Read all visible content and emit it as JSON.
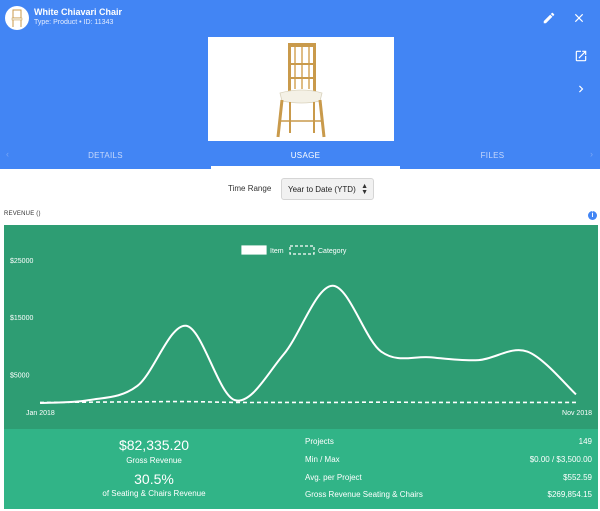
{
  "header": {
    "title": "White Chiavari Chair",
    "subtitle": "Type: Product • ID: 11343"
  },
  "tabs": [
    {
      "label": "DETAILS"
    },
    {
      "label": "USAGE",
      "active": true
    },
    {
      "label": "FILES"
    }
  ],
  "filters": {
    "time_range_label": "Time Range",
    "time_range_value": "Year to Date (YTD)"
  },
  "section": {
    "revenue_label": "REVENUE ()"
  },
  "colors": {
    "header": "#4285f4",
    "chart_bg": "#2e9d73",
    "stats_bg": "#31b487"
  },
  "chart_data": {
    "type": "line",
    "legend": [
      "Item",
      "Category"
    ],
    "legend_position": "top-center",
    "y_ticks": [
      "$25000",
      "$15000",
      "$5000"
    ],
    "x_tick_labels": [
      "Jan 2018",
      "Nov 2018"
    ],
    "ylim": [
      0,
      25000
    ],
    "grid": false,
    "series": [
      {
        "name": "Item",
        "style": "solid",
        "values": [
          0,
          500,
          3000,
          13500,
          500,
          8500,
          20500,
          9000,
          8000,
          7500,
          9000,
          1500
        ]
      },
      {
        "name": "Category",
        "style": "dashed",
        "values": [
          100,
          150,
          200,
          250,
          100,
          100,
          100,
          150,
          100,
          100,
          100,
          100
        ]
      }
    ]
  },
  "stats": {
    "gross_revenue_value": "$82,335.20",
    "gross_revenue_label": "Gross Revenue",
    "percent_value": "30.5%",
    "percent_label": "of Seating & Chairs Revenue",
    "rows": [
      {
        "label": "Projects",
        "value": "149"
      },
      {
        "label": "Min / Max",
        "value": "$0.00 / $3,500.00"
      },
      {
        "label": "Avg. per Project",
        "value": "$552.59"
      },
      {
        "label": "Gross Revenue Seating & Chairs",
        "value": "$269,854.15"
      }
    ]
  }
}
